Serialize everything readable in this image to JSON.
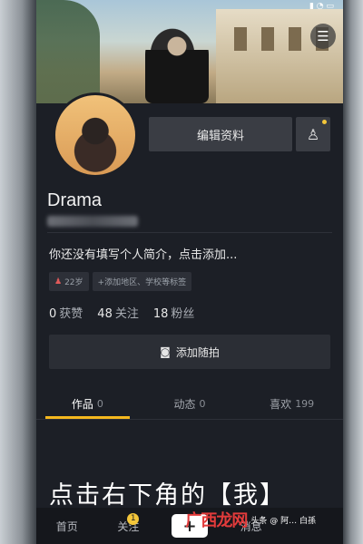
{
  "profile": {
    "name": "Drama",
    "bio": "你还没有填写个人简介，点击添加...",
    "edit_label": "编辑资料",
    "tags": {
      "age": "22岁",
      "region": "+添加地区、学校等标签"
    },
    "stats": [
      {
        "value": "0",
        "label": "获赞"
      },
      {
        "value": "48",
        "label": "关注"
      },
      {
        "value": "18",
        "label": "粉丝"
      }
    ],
    "shoot_label": "添加随拍"
  },
  "tabs": [
    {
      "label": "作品",
      "count": "0"
    },
    {
      "label": "动态",
      "count": "0"
    },
    {
      "label": "喜欢",
      "count": "199"
    }
  ],
  "caption": "点击右下角的【我】",
  "nav": {
    "home": "首页",
    "follow": "关注",
    "follow_badge": "1",
    "plus": "+",
    "me": "消息"
  },
  "watermark": {
    "logo": "广西龙网",
    "text": "头条 @ 阿… 白孫"
  },
  "colors": {
    "tab_accent": "#f5b81e",
    "badge": "#f3c63a"
  }
}
